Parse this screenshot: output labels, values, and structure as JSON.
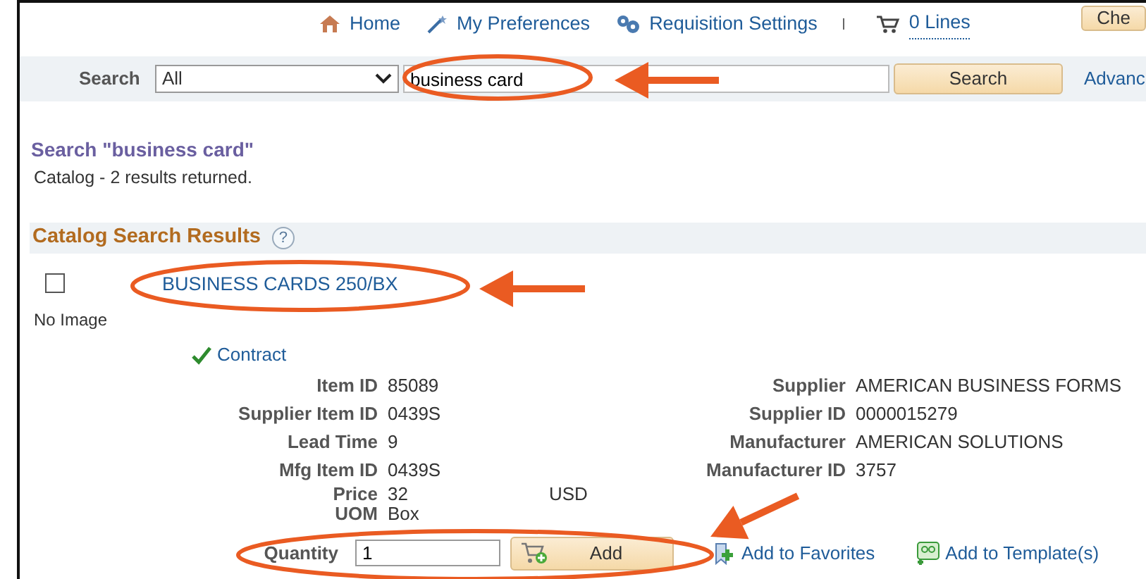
{
  "nav": [
    {
      "kind": "home",
      "label": "Home"
    },
    {
      "kind": "preferences",
      "label": "My Preferences"
    },
    {
      "kind": "settings",
      "label": "Requisition Settings"
    },
    {
      "kind": "cart",
      "label": "0 Lines"
    }
  ],
  "checkout_button": "Che",
  "search": {
    "label": "Search",
    "scope": "All",
    "query": "business card",
    "button": "Search",
    "advanced_link": "Advanc"
  },
  "results": {
    "heading": "Search \"business card\"",
    "summary": "Catalog - 2 results returned."
  },
  "section": {
    "title": "Catalog Search Results",
    "help": "?"
  },
  "item": {
    "checked": false,
    "title": "BUSINESS CARDS 250/BX",
    "no_image": "No Image",
    "contract": "Contract",
    "left": [
      {
        "label": "Item ID",
        "value": "85089"
      },
      {
        "label": "Supplier Item ID",
        "value": "0439S"
      },
      {
        "label": "Lead Time",
        "value": "9"
      },
      {
        "label": "Mfg Item ID",
        "value": "0439S"
      }
    ],
    "right": [
      {
        "label": "Supplier",
        "value": "AMERICAN BUSINESS FORMS"
      },
      {
        "label": "Supplier ID",
        "value": "0000015279"
      },
      {
        "label": "Manufacturer",
        "value": "AMERICAN SOLUTIONS"
      },
      {
        "label": "Manufacturer ID",
        "value": "3757"
      }
    ],
    "price": {
      "label": "Price",
      "value": "32",
      "currency": "USD"
    },
    "uom": {
      "label": "UOM",
      "value": "Box"
    },
    "quantity": {
      "label": "Quantity",
      "value": "1"
    },
    "add_button": "Add",
    "links": [
      {
        "kind": "favorites",
        "label": "Add to Favorites"
      },
      {
        "kind": "template",
        "label": "Add to Template(s)"
      }
    ]
  }
}
